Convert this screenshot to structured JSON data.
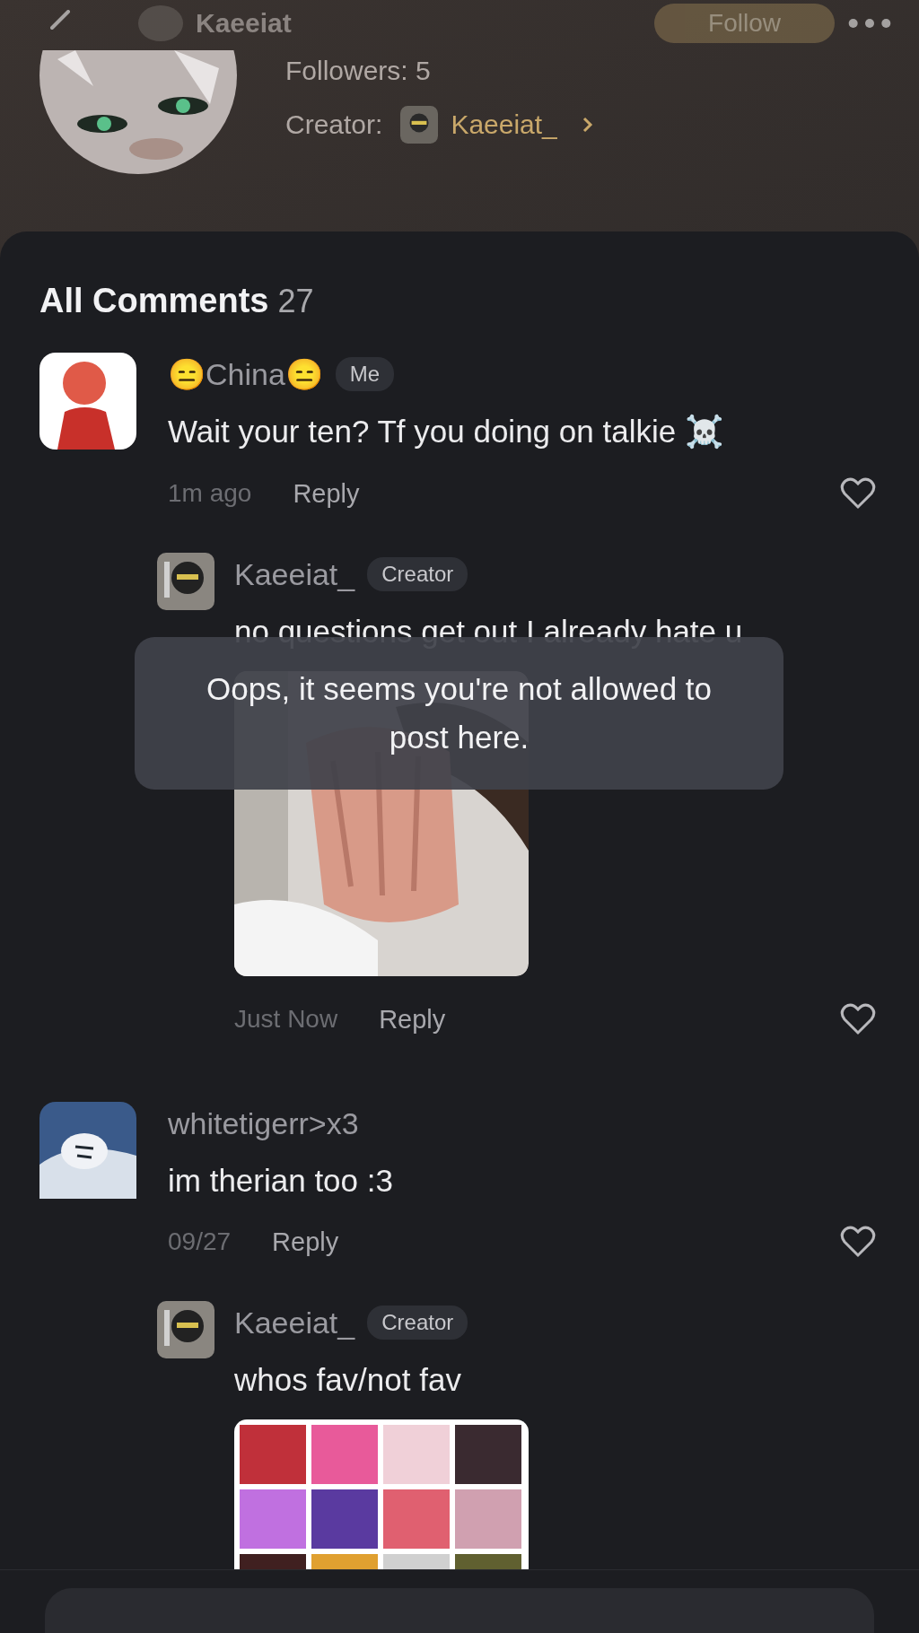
{
  "header": {
    "title": "Kaeeiat",
    "follow_button": "Follow",
    "followers": "Followers: 5",
    "creator_label": "Creator:",
    "creator_name": "Kaeeiat_"
  },
  "comments_header": {
    "title": "All Comments",
    "count": "27"
  },
  "comments": [
    {
      "author": "😑China😑",
      "badge": "Me",
      "text": "Wait your ten? Tf you doing on talkie ☠️",
      "time": "1m ago",
      "reply": "Reply",
      "liked": false,
      "replies": [
        {
          "author": "Kaeeiat_",
          "badge": "Creator",
          "text": "no questions get out I already hate u",
          "time": "Just Now",
          "reply": "Reply",
          "liked": false
        }
      ]
    },
    {
      "author": "whitetigerr>x3",
      "text": "im therian too :3",
      "time": "09/27",
      "reply": "Reply",
      "liked": false,
      "replies": [
        {
          "author": "Kaeeiat_",
          "badge": "Creator",
          "text": "whos fav/not fav"
        }
      ]
    }
  ],
  "toast": {
    "message": "Oops, it seems you're not allowed to post here."
  }
}
